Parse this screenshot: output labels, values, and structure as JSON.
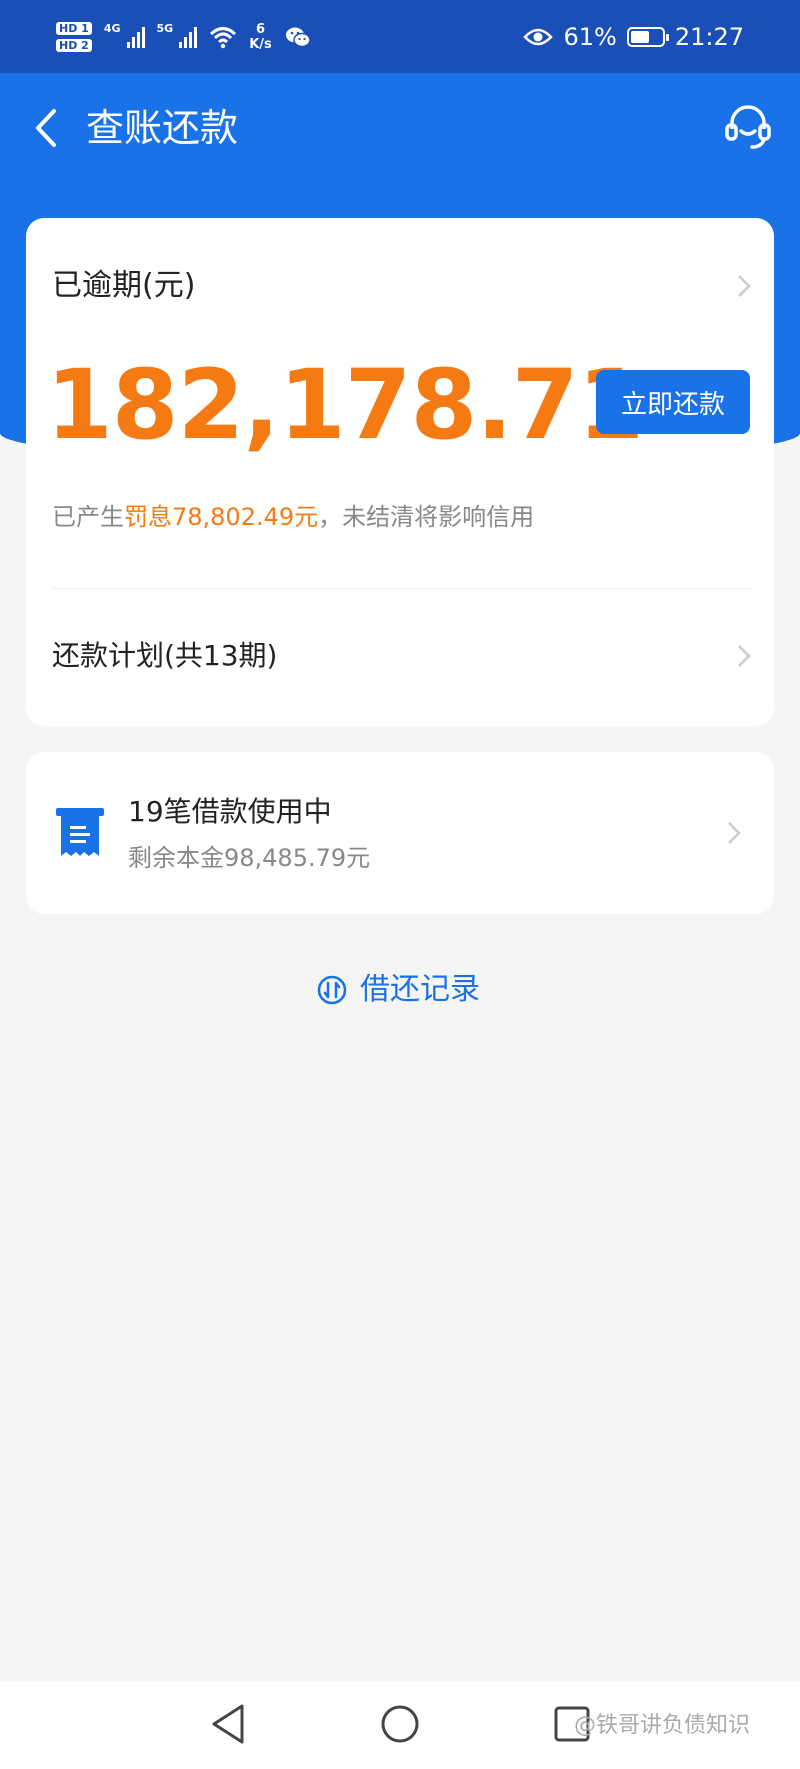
{
  "status_bar": {
    "hd1": "HD 1",
    "hd2": "HD 2",
    "net1": "4G",
    "net2": "5G",
    "speed_value": "6",
    "speed_unit": "K/s",
    "battery_percent": "61%",
    "battery_level": 61,
    "time": "21:27"
  },
  "header": {
    "title": "查账还款"
  },
  "overdue_card": {
    "label": "已逾期(元)",
    "amount": "182,178.71",
    "pay_button": "立即还款",
    "penalty_prefix": "已产生",
    "penalty_highlight": "罚息78,802.49元",
    "penalty_suffix": "，未结清将影响信用",
    "plan_label": "还款计划(共13期)"
  },
  "loans_card": {
    "title": "19笔借款使用中",
    "subtitle": "剩余本金98,485.79元"
  },
  "history": {
    "label": "借还记录"
  },
  "watermark": "@铁哥讲负债知识",
  "colors": {
    "status_bar": "#1a4fb8",
    "header_blue": "#1a72e8",
    "amount_orange": "#f57a14"
  }
}
